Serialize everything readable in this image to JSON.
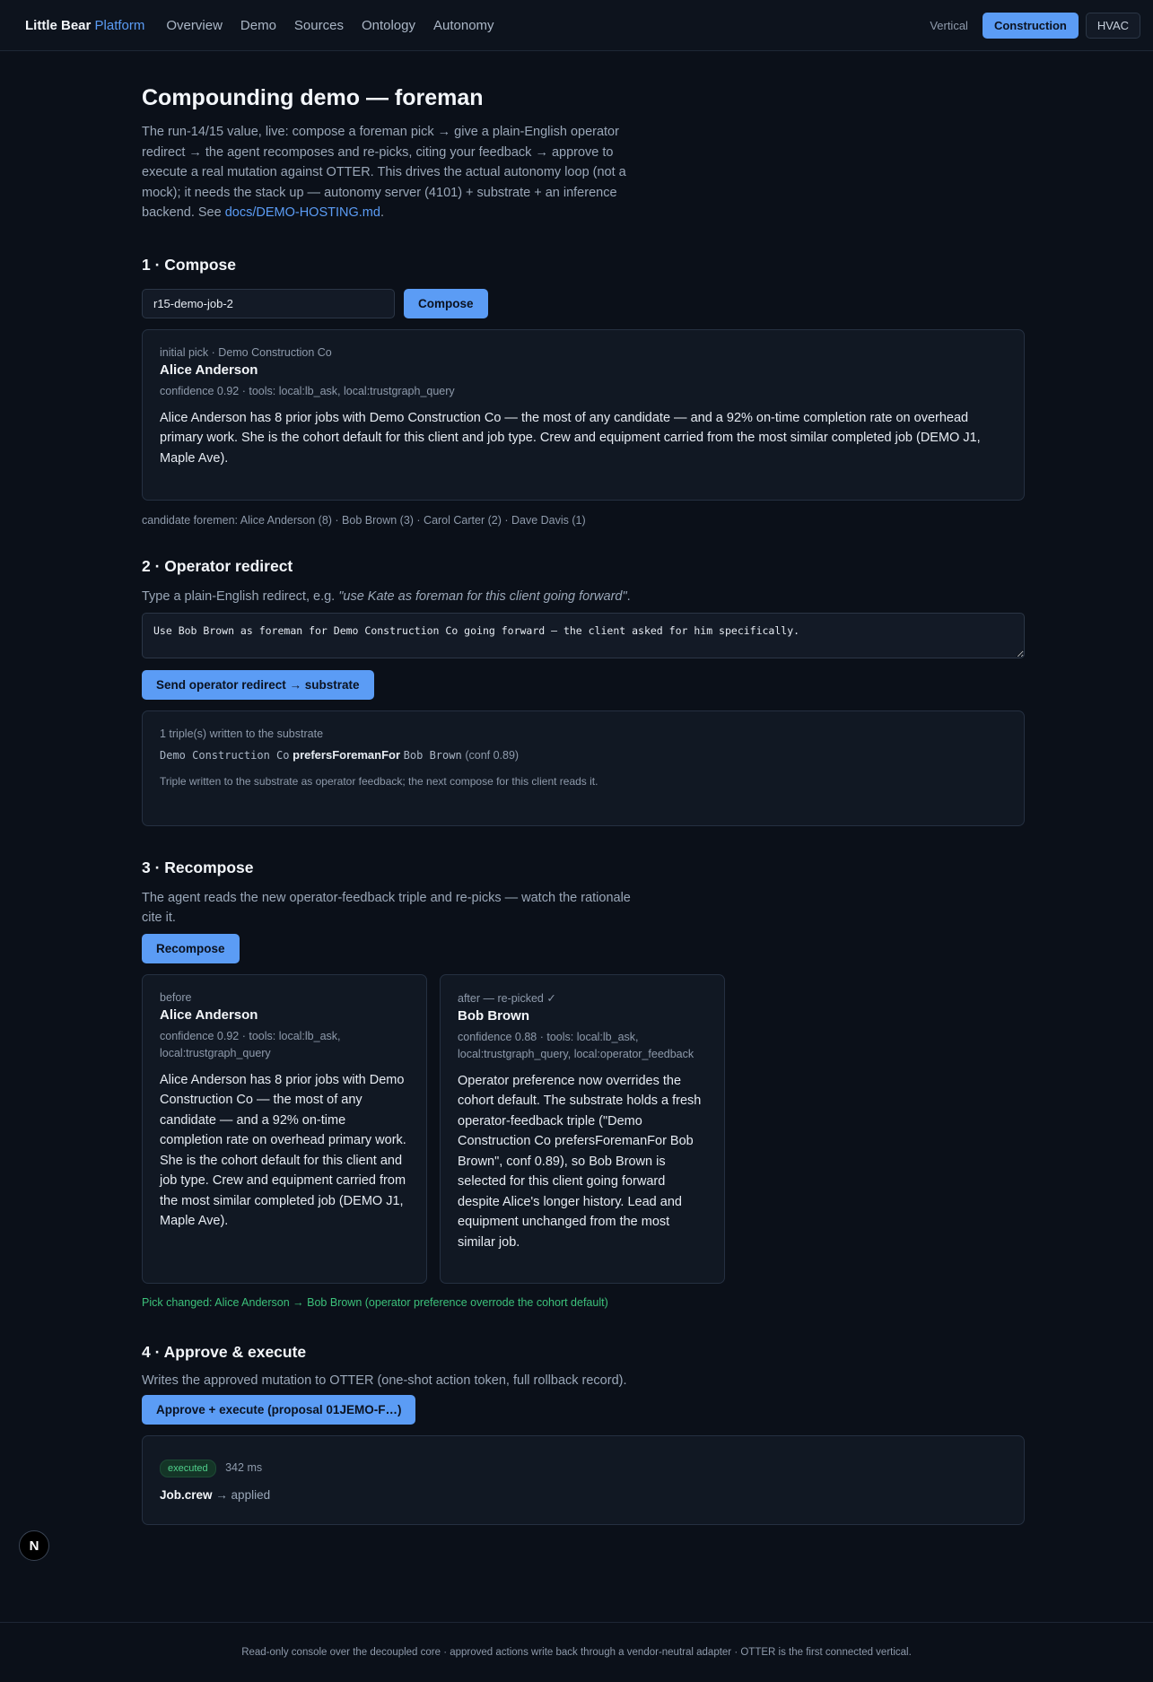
{
  "header": {
    "brand": "Little Bear",
    "brand_accent": "Platform",
    "nav": [
      "Overview",
      "Demo",
      "Sources",
      "Ontology",
      "Autonomy"
    ],
    "vertical_label": "Vertical",
    "verticals": [
      {
        "label": "Construction",
        "active": true
      },
      {
        "label": "HVAC",
        "active": false
      }
    ]
  },
  "page": {
    "title": "Compounding demo — foreman",
    "intro": "The run-14/15 value, live: compose a foreman pick → give a plain-English operator redirect → the agent recomposes and re-picks, citing your feedback → approve to execute a real mutation against OTTER. This drives the actual autonomy loop (not a mock); it needs the stack up — autonomy server (4101) + substrate + an inference backend. See ",
    "intro_link": "docs/DEMO-HOSTING.md",
    "intro_end": "."
  },
  "compose": {
    "heading": "1 · Compose",
    "job_input_value": "r15-demo-job-2",
    "button": "Compose",
    "result": {
      "label": "initial pick · Demo Construction Co",
      "name": "Alice Anderson",
      "meta": "confidence 0.92 · tools: local:lb_ask, local:trustgraph_query",
      "rationale": "Alice Anderson has 8 prior jobs with Demo Construction Co — the most of any candidate — and a 92% on-time completion rate on overhead primary work. She is the cohort default for this client and job type. Crew and equipment carried from the most similar completed job (DEMO J1, Maple Ave)."
    },
    "candidates": "candidate foremen: Alice Anderson (8) · Bob Brown (3) · Carol Carter (2) · Dave Davis (1)"
  },
  "redirect": {
    "heading": "2 · Operator redirect",
    "hint_prefix": "Type a plain-English redirect, e.g. ",
    "hint_example": "\"use Kate as foreman for this client going forward\"",
    "hint_suffix": ".",
    "value": "Use Bob Brown as foreman for Demo Construction Co going forward — the client asked for him specifically.",
    "button": "Send operator redirect → substrate",
    "result": {
      "count": "1 triple(s) written to the substrate",
      "subject": "Demo Construction Co",
      "predicate": "prefersForemanFor",
      "object": "Bob Brown",
      "conf": "(conf 0.89)",
      "note": "Triple written to the substrate as operator feedback; the next compose for this client reads it."
    }
  },
  "recompose": {
    "heading": "3 · Recompose",
    "hint": "The agent reads the new operator-feedback triple and re-picks — watch the rationale cite it.",
    "button": "Recompose",
    "before": {
      "label": "before",
      "name": "Alice Anderson",
      "meta": "confidence 0.92 · tools: local:lb_ask, local:trustgraph_query",
      "rationale": "Alice Anderson has 8 prior jobs with Demo Construction Co — the most of any candidate — and a 92% on-time completion rate on overhead primary work. She is the cohort default for this client and job type. Crew and equipment carried from the most similar completed job (DEMO J1, Maple Ave)."
    },
    "after": {
      "label": "after — re-picked ✓",
      "name": "Bob Brown",
      "meta": "confidence 0.88 · tools: local:lb_ask, local:trustgraph_query, local:operator_feedback",
      "rationale": "Operator preference now overrides the cohort default. The substrate holds a fresh operator-feedback triple (\"Demo Construction Co prefersForemanFor Bob Brown\", conf 0.89), so Bob Brown is selected for this client going forward despite Alice's longer history. Lead and equipment unchanged from the most similar job."
    },
    "changed": "Pick changed: Alice Anderson → Bob Brown (operator preference overrode the cohort default)"
  },
  "approve": {
    "heading": "4 · Approve & execute",
    "hint": "Writes the approved mutation to OTTER (one-shot action token, full rollback record).",
    "button": "Approve + execute (proposal 01JEMO-F…)",
    "status": "executed",
    "duration": "342 ms",
    "entity": "Job.crew",
    "result": "→ applied"
  },
  "footer": "Read-only console over the decoupled core · approved actions write back through a vendor-neutral adapter · OTTER is the first connected vertical.",
  "dev_badge": "N",
  "colors": {
    "accent": "#5b9cf5",
    "success": "#3cc07a",
    "background": "#0b1019"
  }
}
